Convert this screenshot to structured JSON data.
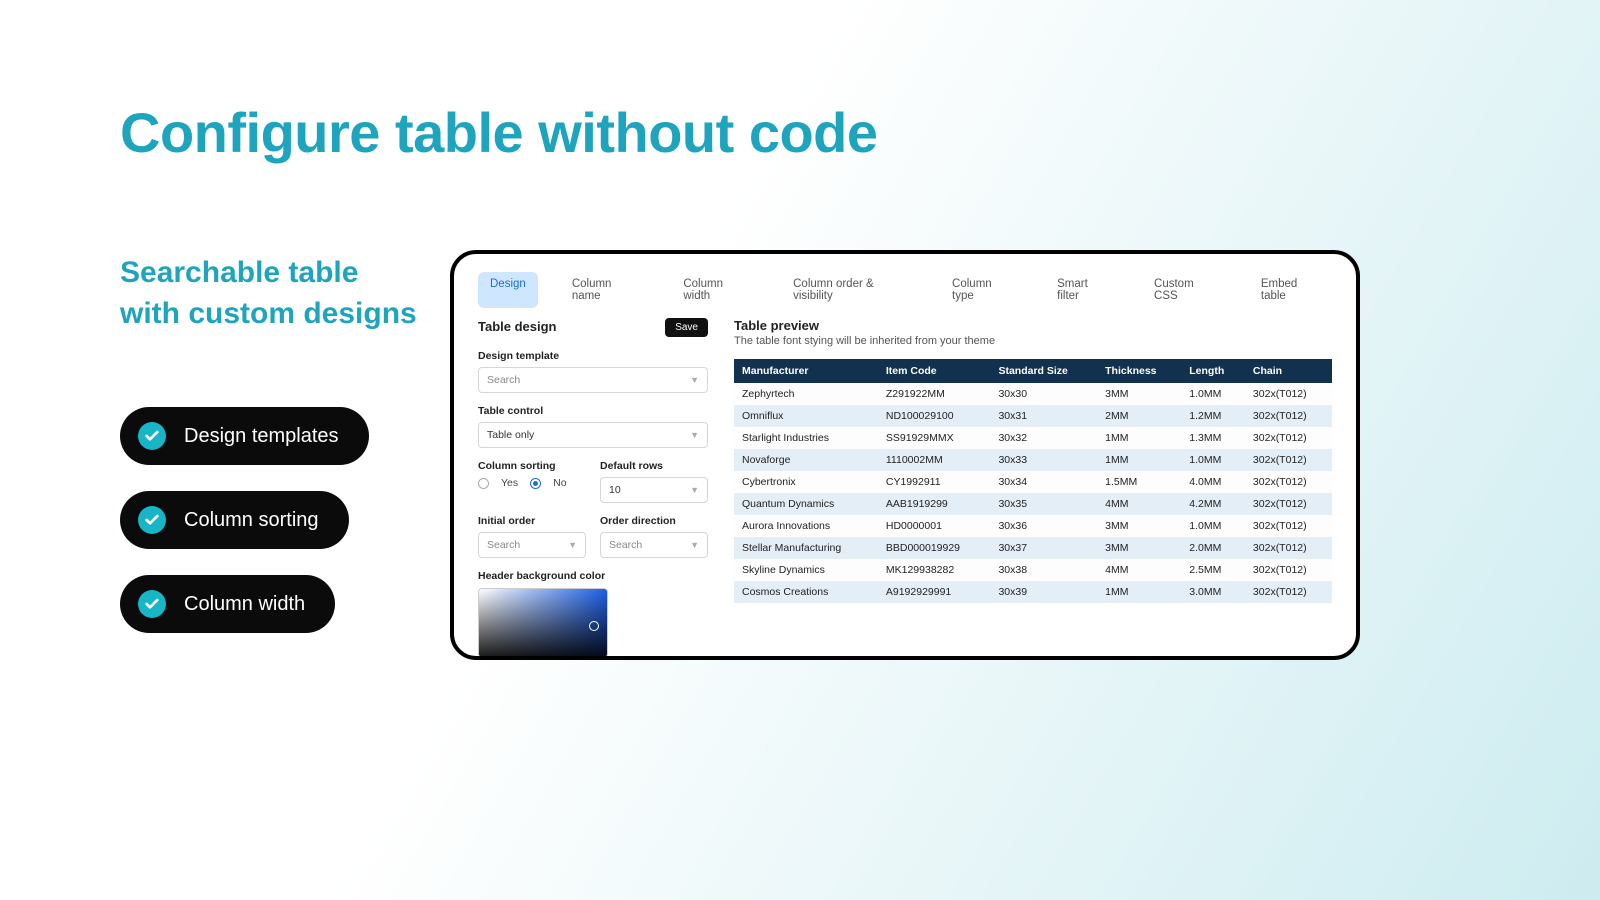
{
  "headline": "Configure table without code",
  "subheadline": "Searchable table with custom designs",
  "chips": [
    "Design templates",
    "Column sorting",
    "Column width"
  ],
  "app": {
    "tabs": [
      "Design",
      "Column name",
      "Column width",
      "Column order & visibility",
      "Column type",
      "Smart filter",
      "Custom CSS",
      "Embed table"
    ],
    "active_tab_index": 0,
    "left": {
      "title": "Table design",
      "save": "Save",
      "design_template_label": "Design template",
      "design_template_value": "Search",
      "table_control_label": "Table control",
      "table_control_value": "Table only",
      "column_sorting_label": "Column sorting",
      "sorting_yes": "Yes",
      "sorting_no": "No",
      "sorting_selected": "No",
      "default_rows_label": "Default rows",
      "default_rows_value": "10",
      "initial_order_label": "Initial order",
      "initial_order_value": "Search",
      "order_direction_label": "Order direction",
      "order_direction_value": "Search",
      "header_bg_label": "Header background color"
    },
    "preview": {
      "title": "Table preview",
      "subtitle": "The table font stying will be inherited from your theme",
      "columns": [
        "Manufacturer",
        "Item Code",
        "Standard Size",
        "Thickness",
        "Length",
        "Chain"
      ],
      "rows": [
        [
          "Zephyrtech",
          "Z291922MM",
          "30x30",
          "3MM",
          "1.0MM",
          "302x(T012)"
        ],
        [
          "Omniflux",
          "ND100029100",
          "30x31",
          "2MM",
          "1.2MM",
          "302x(T012)"
        ],
        [
          "Starlight Industries",
          "SS91929MMX",
          "30x32",
          "1MM",
          "1.3MM",
          "302x(T012)"
        ],
        [
          "Novaforge",
          "1110002MM",
          "30x33",
          "1MM",
          "1.0MM",
          "302x(T012)"
        ],
        [
          "Cybertronix",
          "CY1992911",
          "30x34",
          "1.5MM",
          "4.0MM",
          "302x(T012)"
        ],
        [
          "Quantum Dynamics",
          "AAB1919299",
          "30x35",
          "4MM",
          "4.2MM",
          "302x(T012)"
        ],
        [
          "Aurora Innovations",
          "HD0000001",
          "30x36",
          "3MM",
          "1.0MM",
          "302x(T012)"
        ],
        [
          "Stellar Manufacturing",
          "BBD000019929",
          "30x37",
          "3MM",
          "2.0MM",
          "302x(T012)"
        ],
        [
          "Skyline Dynamics",
          "MK129938282",
          "30x38",
          "4MM",
          "2.5MM",
          "302x(T012)"
        ],
        [
          "Cosmos Creations",
          "A9192929991",
          "30x39",
          "1MM",
          "3.0MM",
          "302x(T012)"
        ]
      ]
    }
  }
}
